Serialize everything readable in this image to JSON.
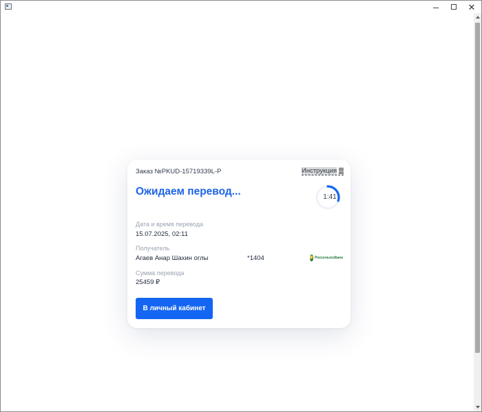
{
  "window": {
    "minimize_glyph": "",
    "close_glyph": "✕"
  },
  "card": {
    "order": "Заказ №PKUD-15719339L-P",
    "instruction": "Инструкция",
    "title": "Ожидаем перевод...",
    "timer": {
      "text": "1:41",
      "progress": 0.3,
      "color": "#1466f2"
    },
    "date_label": "Дата и время перевода",
    "date_value": "15.07.2025, 02:11",
    "recipient_label": "Получатель",
    "recipient_name": "Агаев Анар Шахин оглы",
    "card_mask": "*1404",
    "bank_name": "РоссельхозБанк",
    "amount_label": "Сумма перевода",
    "amount_value": "25459 ₽",
    "button_label": "В личный кабинет"
  },
  "colors": {
    "accent": "#1466f2",
    "title": "#1c63e6"
  }
}
